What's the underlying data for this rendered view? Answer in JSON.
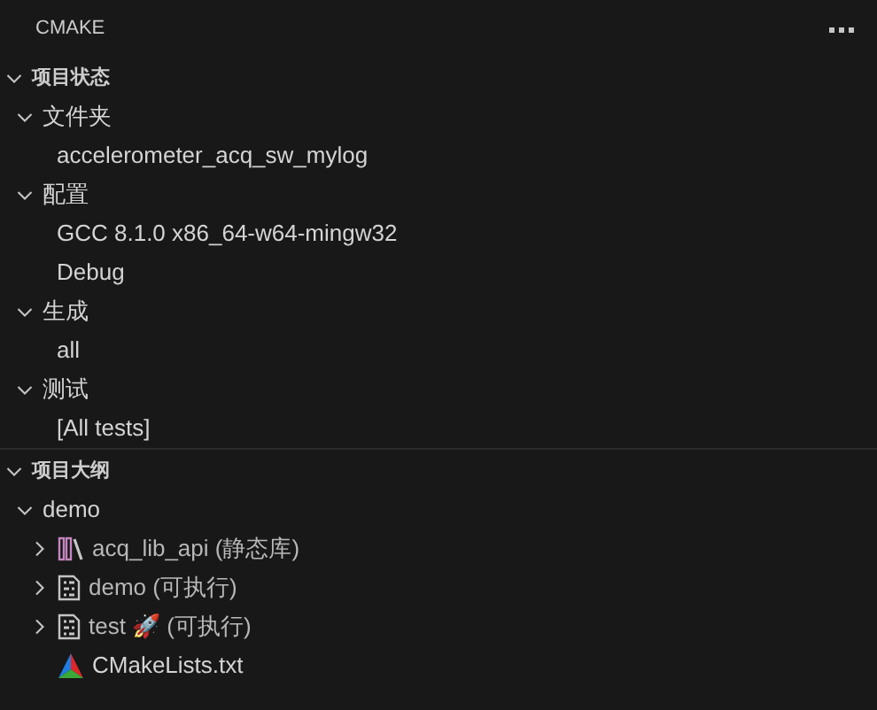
{
  "panel": {
    "title": "CMAKE"
  },
  "sections": [
    {
      "title": "项目状态",
      "expanded": true,
      "children": [
        {
          "label": "文件夹",
          "expanded": true,
          "children": [
            {
              "label": "accelerometer_acq_sw_mylog"
            }
          ]
        },
        {
          "label": "配置",
          "expanded": true,
          "children": [
            {
              "label": "GCC 8.1.0 x86_64-w64-mingw32"
            },
            {
              "label": "Debug"
            }
          ]
        },
        {
          "label": "生成",
          "expanded": true,
          "children": [
            {
              "label": "all"
            }
          ]
        },
        {
          "label": "测试",
          "expanded": true,
          "children": [
            {
              "label": "[All tests]"
            }
          ]
        }
      ]
    },
    {
      "title": "项目大纲",
      "expanded": true,
      "children": [
        {
          "label": "demo",
          "expanded": true,
          "children": [
            {
              "label": "acq_lib_api (静态库)",
              "kind": "library",
              "expanded": false
            },
            {
              "label": "demo (可执行)",
              "kind": "executable",
              "expanded": false
            },
            {
              "label": "test 🚀 (可执行)",
              "kind": "executable",
              "expanded": false
            },
            {
              "label": "CMakeLists.txt",
              "kind": "cmake"
            }
          ]
        }
      ]
    }
  ]
}
